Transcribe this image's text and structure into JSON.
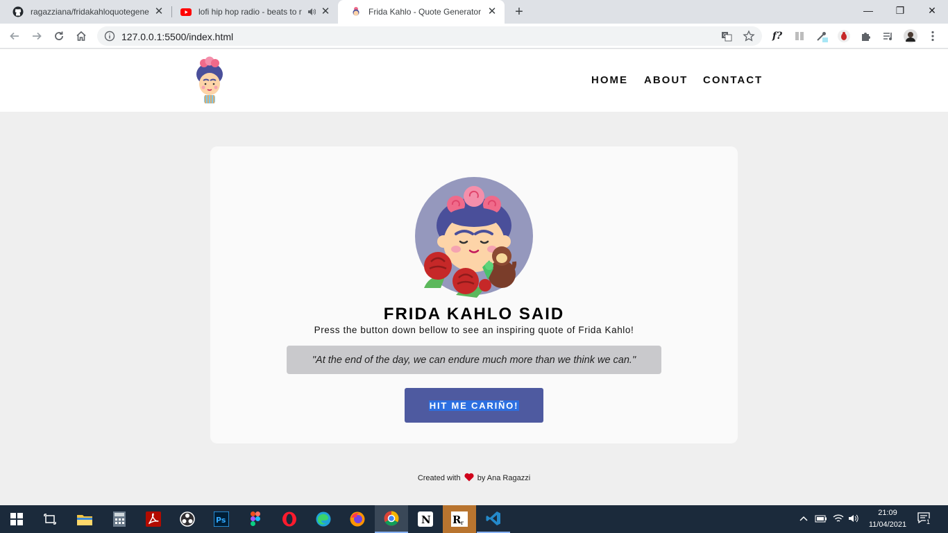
{
  "browser": {
    "tabs": [
      {
        "title": "ragazziana/fridakahloquotegenerator",
        "close": "✕"
      },
      {
        "title": "lofi hip hop radio - beats to relax/study to",
        "close": "✕"
      },
      {
        "title": "Frida Kahlo - Quote Generator",
        "close": "✕"
      }
    ],
    "new_tab": "+",
    "window_controls": {
      "minimize": "—",
      "restore": "❐",
      "close": "✕"
    },
    "url": "127.0.0.1:5500/index.html",
    "extensions": [
      "translate-icon",
      "star-icon",
      "font-f-icon",
      "reader-icon",
      "eyedropper-icon",
      "bug-icon",
      "puzzle-icon",
      "playlist-icon",
      "profile-avatar",
      "kebab-menu-icon"
    ],
    "font_ext_label": "f?"
  },
  "site": {
    "nav": [
      "HOME",
      "ABOUT",
      "CONTACT"
    ],
    "headline": "FRIDA KAHLO SAID",
    "subtitle": "Press the button down bellow to see an inspiring quote of Frida Kahlo!",
    "quote": "\"At the end of the day, we can endure much more than we think we can.\"",
    "button": "HIT ME CARIÑO!",
    "footer": {
      "before": "Created with",
      "after": "by Ana Ragazzi"
    }
  },
  "taskbar": {
    "apps": [
      "windows-start",
      "task-view",
      "file-explorer",
      "calculator",
      "acrobat",
      "obs",
      "photoshop",
      "figma",
      "opera",
      "edge",
      "firefox",
      "chrome",
      "notion",
      "typora",
      "vscode"
    ],
    "time": "21:09",
    "date": "11/04/2021",
    "notifications": "1"
  },
  "colors": {
    "accent_button": "#4e5aa0",
    "card": "#fafafa",
    "quote_bg": "#c9c9cc",
    "page_bg": "#efefef",
    "heart": "#d0021b"
  }
}
